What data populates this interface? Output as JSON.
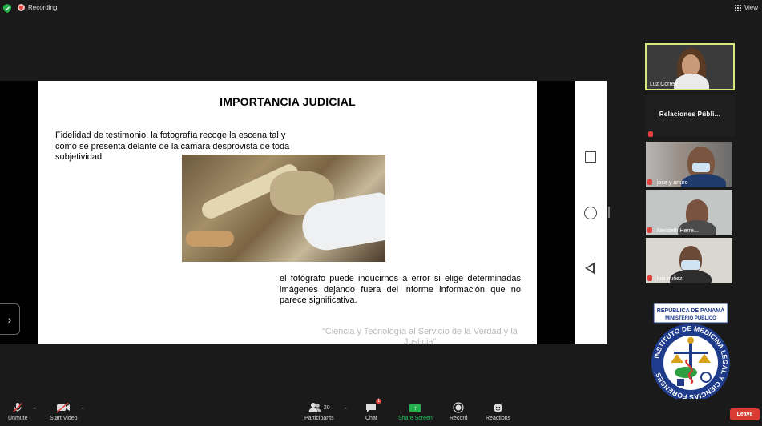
{
  "top_bar": {
    "recording_label": "Recording",
    "view_label": "View"
  },
  "slide": {
    "title": "IMPORTANCIA JUDICIAL",
    "fidelity_text": "Fidelidad de testimonio: la fotografía recoge la escena tal y como se presenta delante de la cámara desprovista de toda subjetividad",
    "error_text": "el fotógrafo puede inducirnos a error si elige determinadas imágenes dejando fuera del informe información que no parece significativa.",
    "footer_quote": "“Ciencia y Tecnología al Servicio de la Verdad y la Justicia”"
  },
  "gallery": {
    "active_name": "Luz Correa",
    "group_name": "Relaciones   Públi...",
    "participants": [
      {
        "name": "jose y arturo"
      },
      {
        "name": "Nerideth Herre..."
      },
      {
        "name": "luis nuñez"
      }
    ]
  },
  "logo": {
    "top_text": "REPÚBLICA DE PANAMÁ",
    "sub_text": "MINISTERIO PÚBLICO",
    "ring_text": "INSTITUTO DE MEDICINA LEGAL Y CIENCIAS FORENSES"
  },
  "toolbar": {
    "unmute": "Unmute",
    "start_video": "Start Video",
    "participants": "Participants",
    "participants_count": "20",
    "chat": "Chat",
    "chat_badge": "1",
    "share_screen": "Share Screen",
    "record": "Record",
    "reactions": "Reactions",
    "leave": "Leave"
  },
  "colors": {
    "accent_green": "#22b14c",
    "leave_red": "#d93a32",
    "active_speaker_border": "#d5e87a"
  }
}
